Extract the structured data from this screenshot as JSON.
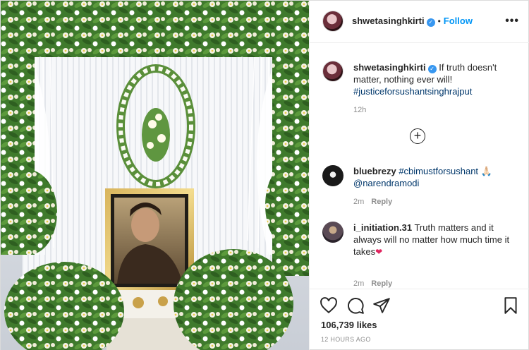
{
  "post": {
    "author": {
      "username": "shwetasinghkirti",
      "verified_icon": "verified-badge-icon",
      "follow_label": "Follow",
      "separator": "•"
    },
    "more_label": "•••",
    "caption": {
      "username": "shwetasinghkirti",
      "text": "If truth doesn't matter, nothing ever will!",
      "hashtag": "#justiceforsushantsinghrajput",
      "time": "12h"
    },
    "load_more_label": "+",
    "comments": [
      {
        "username": "bluebrezy",
        "hashtag": "#cbimustforsushant",
        "emoji": "🙏🏻",
        "mention": "@narendramodi",
        "time": "2m",
        "reply_label": "Reply"
      },
      {
        "username": "i_initiation.31",
        "text": "Truth matters and it always will no matter how much time it takes",
        "emoji": "❤",
        "time": "2m",
        "reply_label": "Reply"
      }
    ],
    "likes": "106,739 likes",
    "posted": "12 HOURS AGO"
  },
  "colors": {
    "link_blue": "#0095f6",
    "hashtag": "#00376b",
    "muted": "#8e8e8e",
    "heart": "#e0245e"
  }
}
